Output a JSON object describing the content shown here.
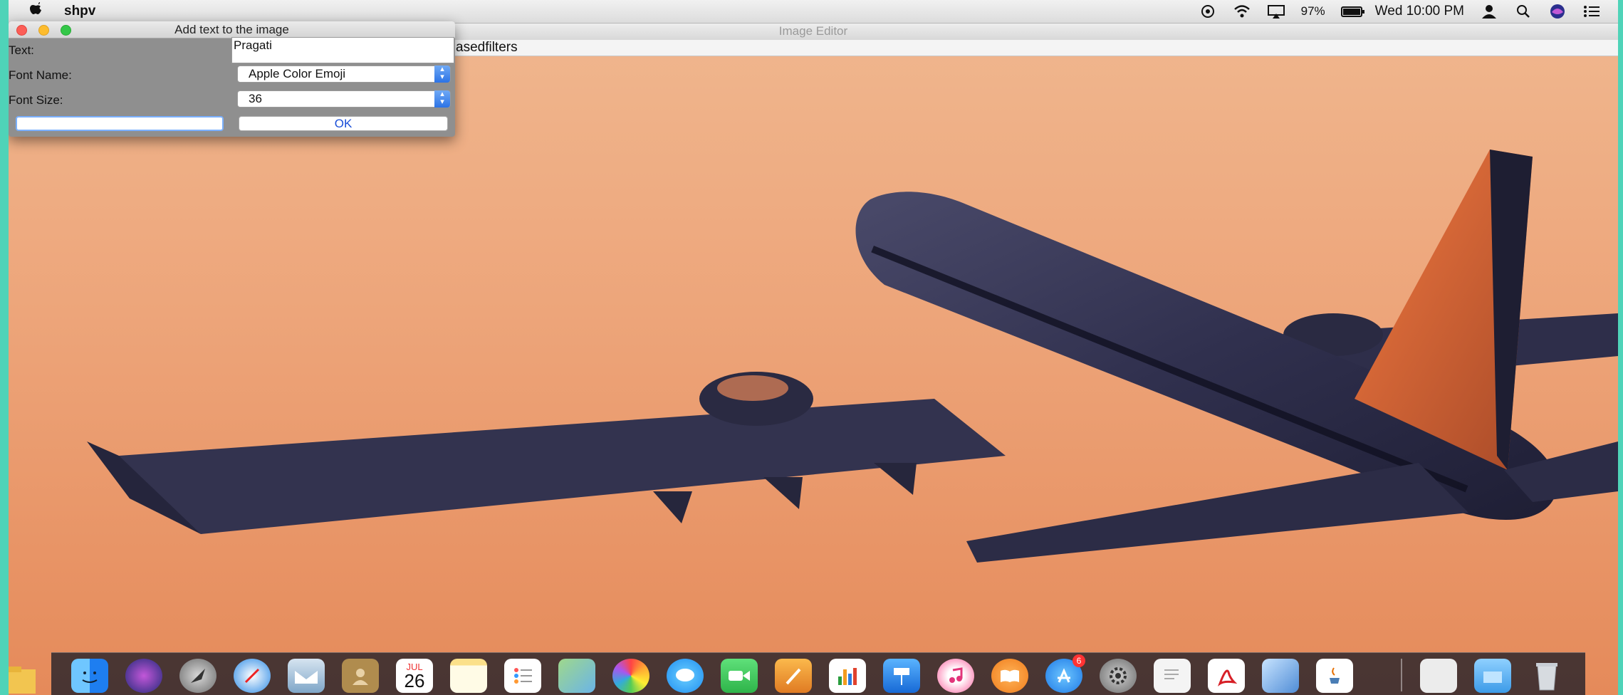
{
  "menubar": {
    "apple_icon": "apple-logo-icon",
    "app_name": "shpv",
    "battery": "97%",
    "clock": "Wed 10:00 PM",
    "icons": [
      "screen-mirror-icon",
      "wifi-icon",
      "airplay-icon",
      "battery-icon",
      "user-icon",
      "spotlight-search-icon",
      "siri-icon",
      "notification-center-icon"
    ]
  },
  "editor": {
    "title": "Image Editor",
    "menu_label": "asedfilters"
  },
  "dialog": {
    "title": "Add text to the image",
    "text_label": "Text:",
    "text_value": "Pragati",
    "font_name_label": "Font Name:",
    "font_name_value": "Apple Color Emoji",
    "font_size_label": "Font Size:",
    "font_size_value": "36",
    "ok_label": "OK"
  },
  "dock": {
    "apps": [
      "finder-icon",
      "siri-icon",
      "launchpad-icon",
      "safari-icon",
      "mail-icon",
      "contacts-icon",
      "calendar-icon",
      "notes-icon",
      "reminders-icon",
      "maps-icon",
      "photos-icon",
      "messages-icon",
      "facetime-icon",
      "pages-icon",
      "numbers-icon",
      "keynote-icon",
      "itunes-icon",
      "ibooks-icon",
      "app-store-icon",
      "system-preferences-icon",
      "textedit-icon",
      "acrobat-icon",
      "virtualbox-icon",
      "java-icon",
      "documents-icon",
      "downloads-folder-icon",
      "trash-icon"
    ],
    "calendar_month": "JUL",
    "calendar_day": "26",
    "app_store_badge": "6"
  }
}
